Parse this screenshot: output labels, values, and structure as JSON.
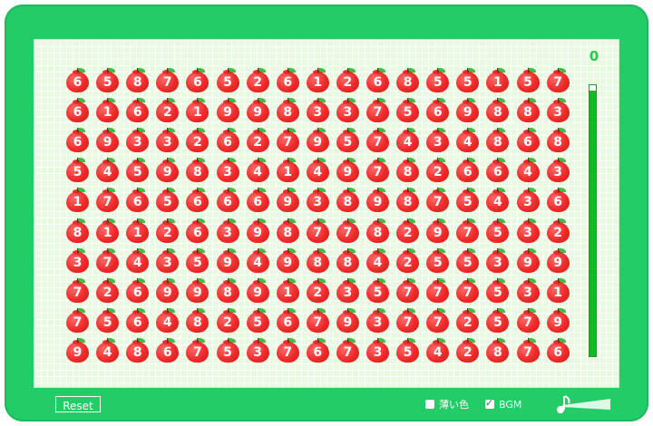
{
  "score": "0",
  "timer_fraction": 0.98,
  "grid": [
    [
      6,
      5,
      8,
      7,
      6,
      5,
      2,
      6,
      1,
      2,
      6,
      8,
      5,
      5,
      1,
      5,
      7
    ],
    [
      6,
      1,
      6,
      2,
      1,
      9,
      9,
      8,
      3,
      3,
      7,
      5,
      6,
      9,
      8,
      8,
      3
    ],
    [
      6,
      9,
      3,
      3,
      2,
      6,
      2,
      7,
      9,
      5,
      7,
      4,
      3,
      4,
      8,
      6,
      8
    ],
    [
      5,
      4,
      5,
      9,
      8,
      3,
      4,
      1,
      4,
      9,
      7,
      8,
      2,
      6,
      6,
      4,
      3
    ],
    [
      1,
      7,
      6,
      5,
      6,
      6,
      6,
      9,
      3,
      8,
      9,
      8,
      7,
      5,
      4,
      3,
      6
    ],
    [
      8,
      1,
      1,
      2,
      6,
      3,
      9,
      8,
      7,
      7,
      8,
      2,
      9,
      7,
      5,
      3,
      2
    ],
    [
      3,
      7,
      4,
      3,
      5,
      9,
      4,
      9,
      8,
      8,
      4,
      2,
      5,
      5,
      3,
      9,
      9
    ],
    [
      7,
      2,
      6,
      9,
      9,
      8,
      9,
      1,
      2,
      3,
      5,
      7,
      7,
      7,
      5,
      3,
      1
    ],
    [
      7,
      5,
      6,
      4,
      8,
      2,
      5,
      6,
      7,
      9,
      3,
      7,
      7,
      2,
      5,
      7,
      9
    ],
    [
      9,
      4,
      8,
      6,
      7,
      5,
      3,
      7,
      6,
      7,
      3,
      5,
      4,
      2,
      8,
      7,
      6
    ]
  ],
  "controls": {
    "reset_label": "Reset",
    "light_color_label": "薄い色",
    "light_color_checked": false,
    "bgm_label": "BGM",
    "bgm_checked": true,
    "volume_icon": "music-note-icon"
  },
  "colors": {
    "frame": "#22cc66",
    "apple": "#ee2a2a",
    "timer": "#11bb22",
    "score": "#22cc44"
  }
}
